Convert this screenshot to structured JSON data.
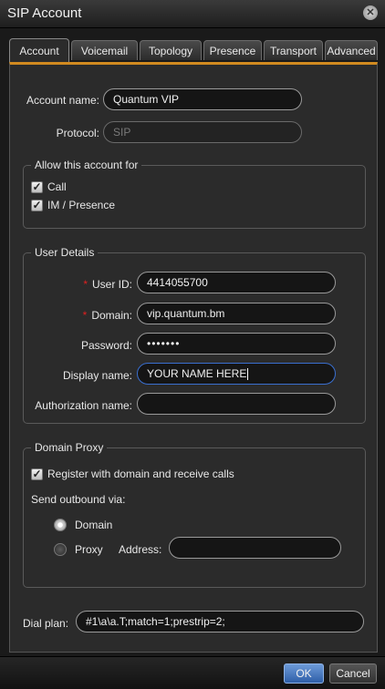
{
  "window": {
    "title": "SIP Account",
    "close_icon": "close-icon"
  },
  "tabs": [
    {
      "label": "Account",
      "active": true
    },
    {
      "label": "Voicemail"
    },
    {
      "label": "Topology"
    },
    {
      "label": "Presence"
    },
    {
      "label": "Transport"
    },
    {
      "label": "Advanced"
    }
  ],
  "account": {
    "name_label": "Account name:",
    "name_value": "Quantum VIP",
    "protocol_label": "Protocol:",
    "protocol_value": "SIP"
  },
  "allow": {
    "legend": "Allow this account for",
    "call_label": "Call",
    "call_checked": true,
    "im_label": "IM / Presence",
    "im_checked": true
  },
  "user_details": {
    "legend": "User Details",
    "required_mark": "*",
    "user_id_label": "User ID:",
    "user_id_value": "4414055700",
    "domain_label": "Domain:",
    "domain_value": "vip.quantum.bm",
    "password_label": "Password:",
    "password_value": "•••••••",
    "display_name_label": "Display name:",
    "display_name_value": "YOUR NAME HERE",
    "auth_name_label": "Authorization name:",
    "auth_name_value": ""
  },
  "domain_proxy": {
    "legend": "Domain Proxy",
    "register_label": "Register with domain and receive calls",
    "register_checked": true,
    "send_via_label": "Send outbound via:",
    "domain_option": "Domain",
    "proxy_option": "Proxy",
    "selected": "Domain",
    "address_label": "Address:",
    "address_value": ""
  },
  "dial_plan": {
    "label": "Dial plan:",
    "value": "#1\\a\\a.T;match=1;prestrip=2;"
  },
  "footer": {
    "ok_label": "OK",
    "cancel_label": "Cancel"
  },
  "colors": {
    "accent": "#d18a20",
    "required": "#e02020",
    "focus": "#3a6fd0"
  }
}
